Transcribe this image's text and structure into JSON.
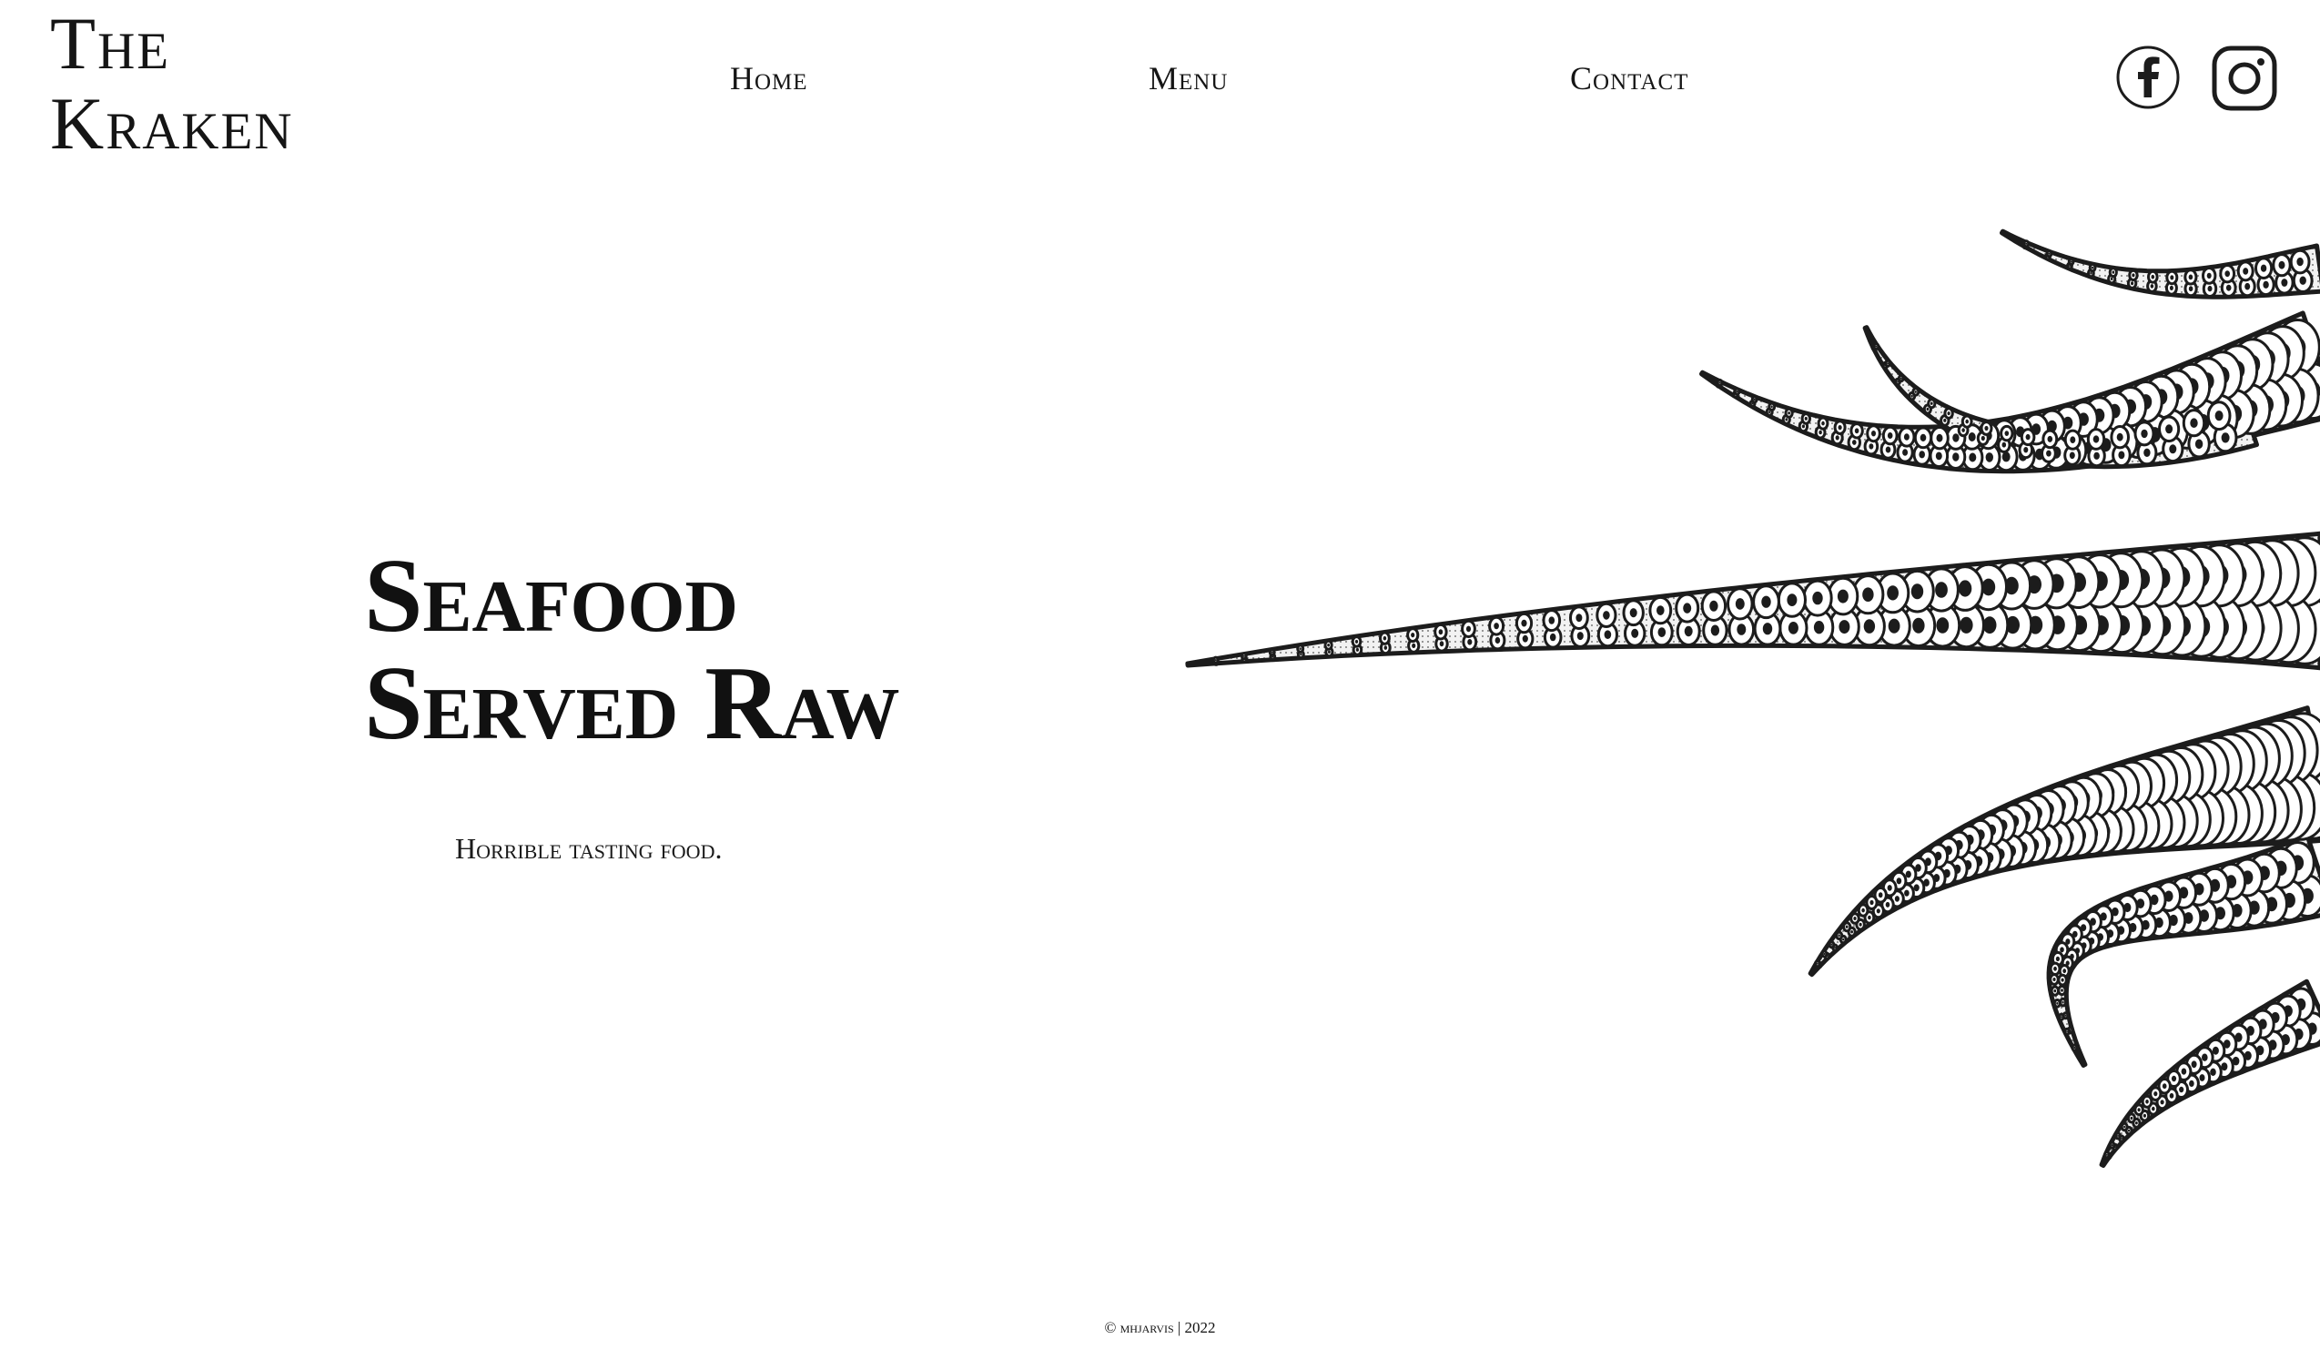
{
  "header": {
    "logo_line1": "The",
    "logo_line2": "Kraken"
  },
  "nav": {
    "items": [
      {
        "label": "Home"
      },
      {
        "label": "Menu"
      },
      {
        "label": "Contact"
      }
    ]
  },
  "social": {
    "facebook_icon": "facebook-icon",
    "instagram_icon": "instagram-icon"
  },
  "hero": {
    "title_line1": "Seafood",
    "title_line2": "Served Raw",
    "subtitle": "Horrible tasting food.",
    "illustration_icon": "kraken-tentacles-illustration"
  },
  "footer": {
    "copyright": "© mhjarvis | 2022"
  },
  "colors": {
    "background": "#ffffff",
    "text": "#111111",
    "ink": "#1c1c1c"
  }
}
